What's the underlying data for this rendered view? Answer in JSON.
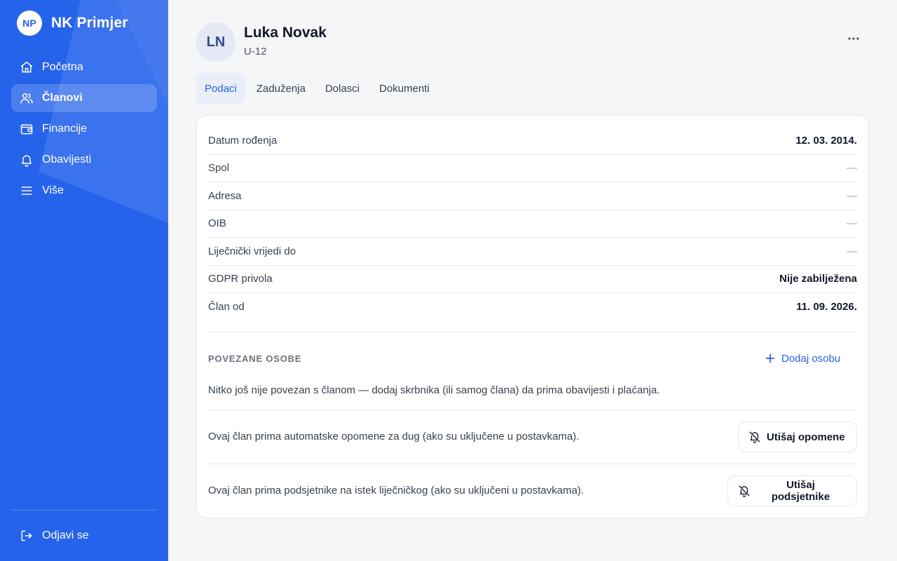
{
  "brand": {
    "logo_text": "NP",
    "name": "NK Primjer"
  },
  "nav": {
    "items": [
      {
        "label": "Početna",
        "icon": "home-icon"
      },
      {
        "label": "Članovi",
        "icon": "users-icon",
        "active": true
      },
      {
        "label": "Financije",
        "icon": "wallet-icon"
      },
      {
        "label": "Obavijesti",
        "icon": "bell-icon"
      },
      {
        "label": "Više",
        "icon": "menu-icon"
      }
    ],
    "logout_label": "Odjavi se"
  },
  "member": {
    "initials": "LN",
    "name": "Luka Novak",
    "code": "U-12"
  },
  "tabs": [
    {
      "label": "Podaci",
      "active": true
    },
    {
      "label": "Zaduženja"
    },
    {
      "label": "Dolasci"
    },
    {
      "label": "Dokumenti"
    }
  ],
  "details": [
    {
      "label": "Datum rođenja",
      "value": "12. 03. 2014."
    },
    {
      "label": "Spol",
      "value": "—"
    },
    {
      "label": "Adresa",
      "value": "—"
    },
    {
      "label": "OIB",
      "value": "—"
    },
    {
      "label": "Liječnički vrijedi do",
      "value": "—"
    },
    {
      "label": "GDPR privola",
      "value": "Nije zabilježena"
    },
    {
      "label": "Član od",
      "value": "11. 09. 2026."
    }
  ],
  "related": {
    "title": "POVEZANE OSOBE",
    "add_label": "Dodaj osobu",
    "empty_message": "Nitko još nije povezan s članom — dodaj skrbnika (ili samog člana) da prima obavijesti i plaćanja."
  },
  "notices": {
    "debt_text": "Ovaj član prima automatske opomene za dug (ako su uključene u postavkama).",
    "debt_button": "Utišaj opomene",
    "medical_text": "Ovaj član prima podsjetnike na istek liječničkog (ako su uključeni u postavkama).",
    "medical_button": "Utišaj podsjetnike"
  },
  "colors": {
    "accent": "#2563eb",
    "background": "#f5f6f8",
    "card": "#ffffff"
  }
}
